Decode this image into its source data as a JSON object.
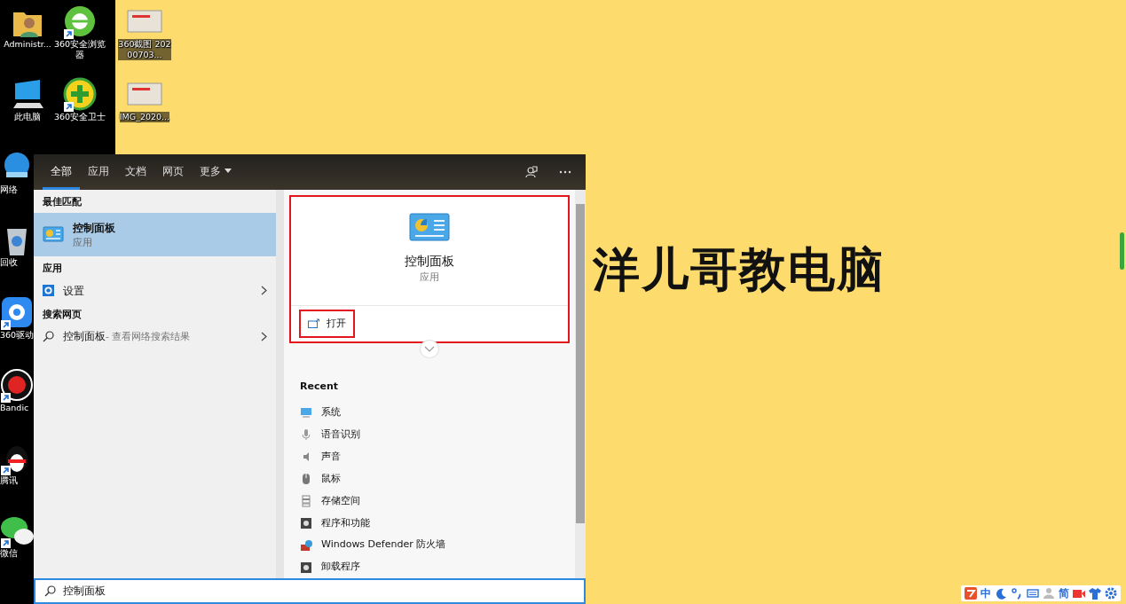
{
  "desktop_columns": [
    [
      {
        "label": "Administr...",
        "kind": "user-folder",
        "shortcut": false
      },
      {
        "label": "此电脑",
        "kind": "computer",
        "shortcut": false
      },
      {
        "label": "网络",
        "kind": "network",
        "shortcut": false
      },
      {
        "label": "回收",
        "kind": "recycle",
        "shortcut": false
      },
      {
        "label": "360驱动",
        "kind": "driver",
        "shortcut": true
      },
      {
        "label": "Bandic",
        "kind": "record",
        "shortcut": true
      },
      {
        "label": "腾讯",
        "kind": "penguin",
        "shortcut": true
      },
      {
        "label": "微信",
        "kind": "chat",
        "shortcut": true
      }
    ],
    [
      {
        "label": "360安全浏览器",
        "kind": "browser",
        "shortcut": true
      },
      {
        "label": "360安全卫士",
        "kind": "guard",
        "shortcut": true
      }
    ],
    [
      {
        "label": "360截图 20200703...",
        "kind": "thumbnail",
        "shortcut": false
      },
      {
        "label": "IMG_2020...",
        "kind": "thumbnail",
        "shortcut": false
      }
    ]
  ],
  "overlay_title": "洋儿哥教电脑",
  "search_window": {
    "tabs": [
      {
        "label": "全部",
        "selected": true,
        "menu": false
      },
      {
        "label": "应用",
        "selected": false,
        "menu": false
      },
      {
        "label": "文档",
        "selected": false,
        "menu": false
      },
      {
        "label": "网页",
        "selected": false,
        "menu": false
      },
      {
        "label": "更多",
        "selected": false,
        "menu": true
      }
    ],
    "sections": [
      {
        "heading": "最佳匹配",
        "items": [
          {
            "kind": "app",
            "title": "控制面板",
            "subtitle": "应用",
            "selected": true,
            "chevron": false
          }
        ]
      },
      {
        "heading": "应用",
        "items": [
          {
            "kind": "setting",
            "title": "设置",
            "selected": false,
            "chevron": true
          }
        ]
      },
      {
        "heading": "搜索网页",
        "items": [
          {
            "kind": "web",
            "title": "控制面板",
            "hint": " - 查看网络搜索结果",
            "selected": false,
            "chevron": true
          }
        ]
      }
    ],
    "preview": {
      "title": "控制面板",
      "subtitle": "应用",
      "highlighted": true
    },
    "actions": [
      {
        "label": "打开",
        "highlighted": true
      }
    ],
    "recent": {
      "heading": "Recent",
      "items": [
        {
          "kind": "system",
          "label": "系统"
        },
        {
          "kind": "speech",
          "label": "语音识别"
        },
        {
          "kind": "sound",
          "label": "声音"
        },
        {
          "kind": "mouse",
          "label": "鼠标"
        },
        {
          "kind": "storage",
          "label": "存储空间"
        },
        {
          "kind": "programs",
          "label": "程序和功能"
        },
        {
          "kind": "firewall",
          "label": "Windows Defender 防火墙"
        },
        {
          "kind": "programs",
          "label": "卸载程序"
        }
      ]
    },
    "search": {
      "value": "控制面板"
    }
  },
  "tray": [
    {
      "kind": "logo"
    },
    {
      "kind": "text",
      "label": "中"
    },
    {
      "kind": "moon"
    },
    {
      "kind": "punct"
    },
    {
      "kind": "keyboard"
    },
    {
      "kind": "user"
    },
    {
      "kind": "text",
      "label": "简"
    },
    {
      "kind": "video"
    },
    {
      "kind": "shirt"
    },
    {
      "kind": "gear"
    }
  ]
}
